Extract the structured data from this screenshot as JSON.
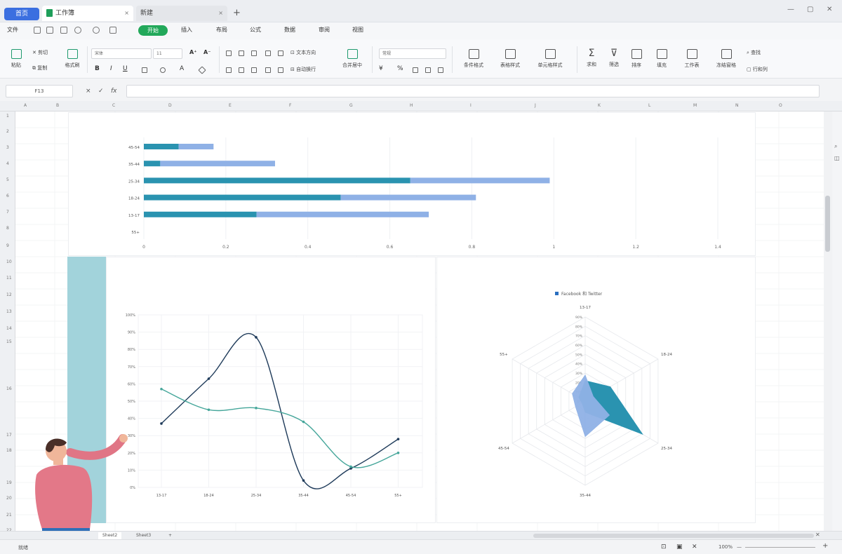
{
  "titlebar": {
    "home_tab": "首页",
    "workbook_tab": "工作簿",
    "new_tab": "新建",
    "add_tab": "+",
    "close_glyph": "×",
    "window_minimize": "—",
    "window_restore": "▢",
    "window_close": "✕"
  },
  "menu": {
    "file": "文件",
    "start": "开始",
    "insert": "插入",
    "layout": "布局",
    "formula": "公式",
    "data": "数据",
    "review": "审阅",
    "view": "视图"
  },
  "toolbar": {
    "paste": "粘贴",
    "cut": "剪切",
    "copy": "复制",
    "format_painter": "格式刷",
    "font_name": "宋体",
    "font_size": "11",
    "bold": "B",
    "italic": "I",
    "underline": "U",
    "wrap_text": "文本方向",
    "auto_wrap": "自动换行",
    "merge": "合并居中",
    "number_format": "常规",
    "conditional_format": "条件格式",
    "table_style": "表格样式",
    "cell_style": "单元格样式",
    "sum": "求和",
    "filter": "筛选",
    "sort": "排序",
    "fill": "填充",
    "worksheet": "工作表",
    "freeze": "冻结窗格",
    "find": "查找",
    "rows_cols": "行和列"
  },
  "formula_bar": {
    "cell_ref": "F13",
    "cancel": "×",
    "confirm": "✓",
    "fx": "fx",
    "value": ""
  },
  "grid": {
    "columns": [
      "A",
      "B",
      "C",
      "D",
      "E",
      "F",
      "G",
      "H",
      "I",
      "J",
      "K",
      "L",
      "M",
      "N",
      "O"
    ],
    "rows": [
      "1",
      "2",
      "3",
      "4",
      "5",
      "6",
      "7",
      "8",
      "9",
      "10",
      "11",
      "12",
      "13",
      "14",
      "15",
      "16",
      "17",
      "18",
      "19",
      "20",
      "21",
      "22"
    ]
  },
  "sheets": {
    "tabs": [
      "Sheet2",
      "Sheet3"
    ],
    "add": "+"
  },
  "status": {
    "left_text": "就绪",
    "zoom": "100%",
    "zoom_minus": "—",
    "zoom_plus": "+"
  },
  "chart_data": [
    {
      "type": "bar",
      "orientation": "horizontal",
      "stacked": true,
      "categories": [
        "45-54",
        "35-44",
        "25-34",
        "18-24",
        "13-17",
        "55+"
      ],
      "series": [
        {
          "values": [
            0.085,
            0.04,
            0.65,
            0.48,
            0.275,
            0
          ],
          "color": "#2a93b0"
        },
        {
          "values": [
            0.085,
            0.28,
            0.34,
            0.33,
            0.42,
            0
          ],
          "color": "#8fb1e6"
        }
      ],
      "xticks": [
        "0",
        "0.2",
        "0.4",
        "0.6",
        "0.8",
        "1",
        "1.2",
        "1.4"
      ],
      "xlim": [
        0,
        1.4
      ],
      "grid": "vertical"
    },
    {
      "type": "line",
      "categories": [
        "13-17",
        "18-24",
        "25-34",
        "35-44",
        "45-54",
        "55+"
      ],
      "series": [
        {
          "values": [
            37,
            63,
            87,
            4,
            11,
            28
          ],
          "color": "#1f3b5a"
        },
        {
          "values": [
            57,
            45,
            46,
            38,
            12,
            20
          ],
          "color": "#45a69a"
        }
      ],
      "yticks": [
        "0%",
        "10%",
        "20%",
        "30%",
        "40%",
        "50%",
        "60%",
        "70%",
        "80%",
        "90%",
        "100%"
      ],
      "ylim": [
        0,
        100
      ]
    },
    {
      "type": "radar",
      "categories": [
        "13-17",
        "18-24",
        "25-34",
        "35-44",
        "45-54",
        "55+"
      ],
      "legend": "Facebook 和 Twitter",
      "series": [
        {
          "values": [
            22,
            31,
            71,
            12,
            4,
            8
          ],
          "color": "#2a93b0"
        },
        {
          "values": [
            28,
            10,
            30,
            38,
            12,
            16
          ],
          "color": "#8fb1e6"
        }
      ],
      "rticks": [
        "0%",
        "10%",
        "20%",
        "30%",
        "40%",
        "50%",
        "60%",
        "70%",
        "80%",
        "90%"
      ],
      "rlim": [
        0,
        90
      ]
    }
  ]
}
